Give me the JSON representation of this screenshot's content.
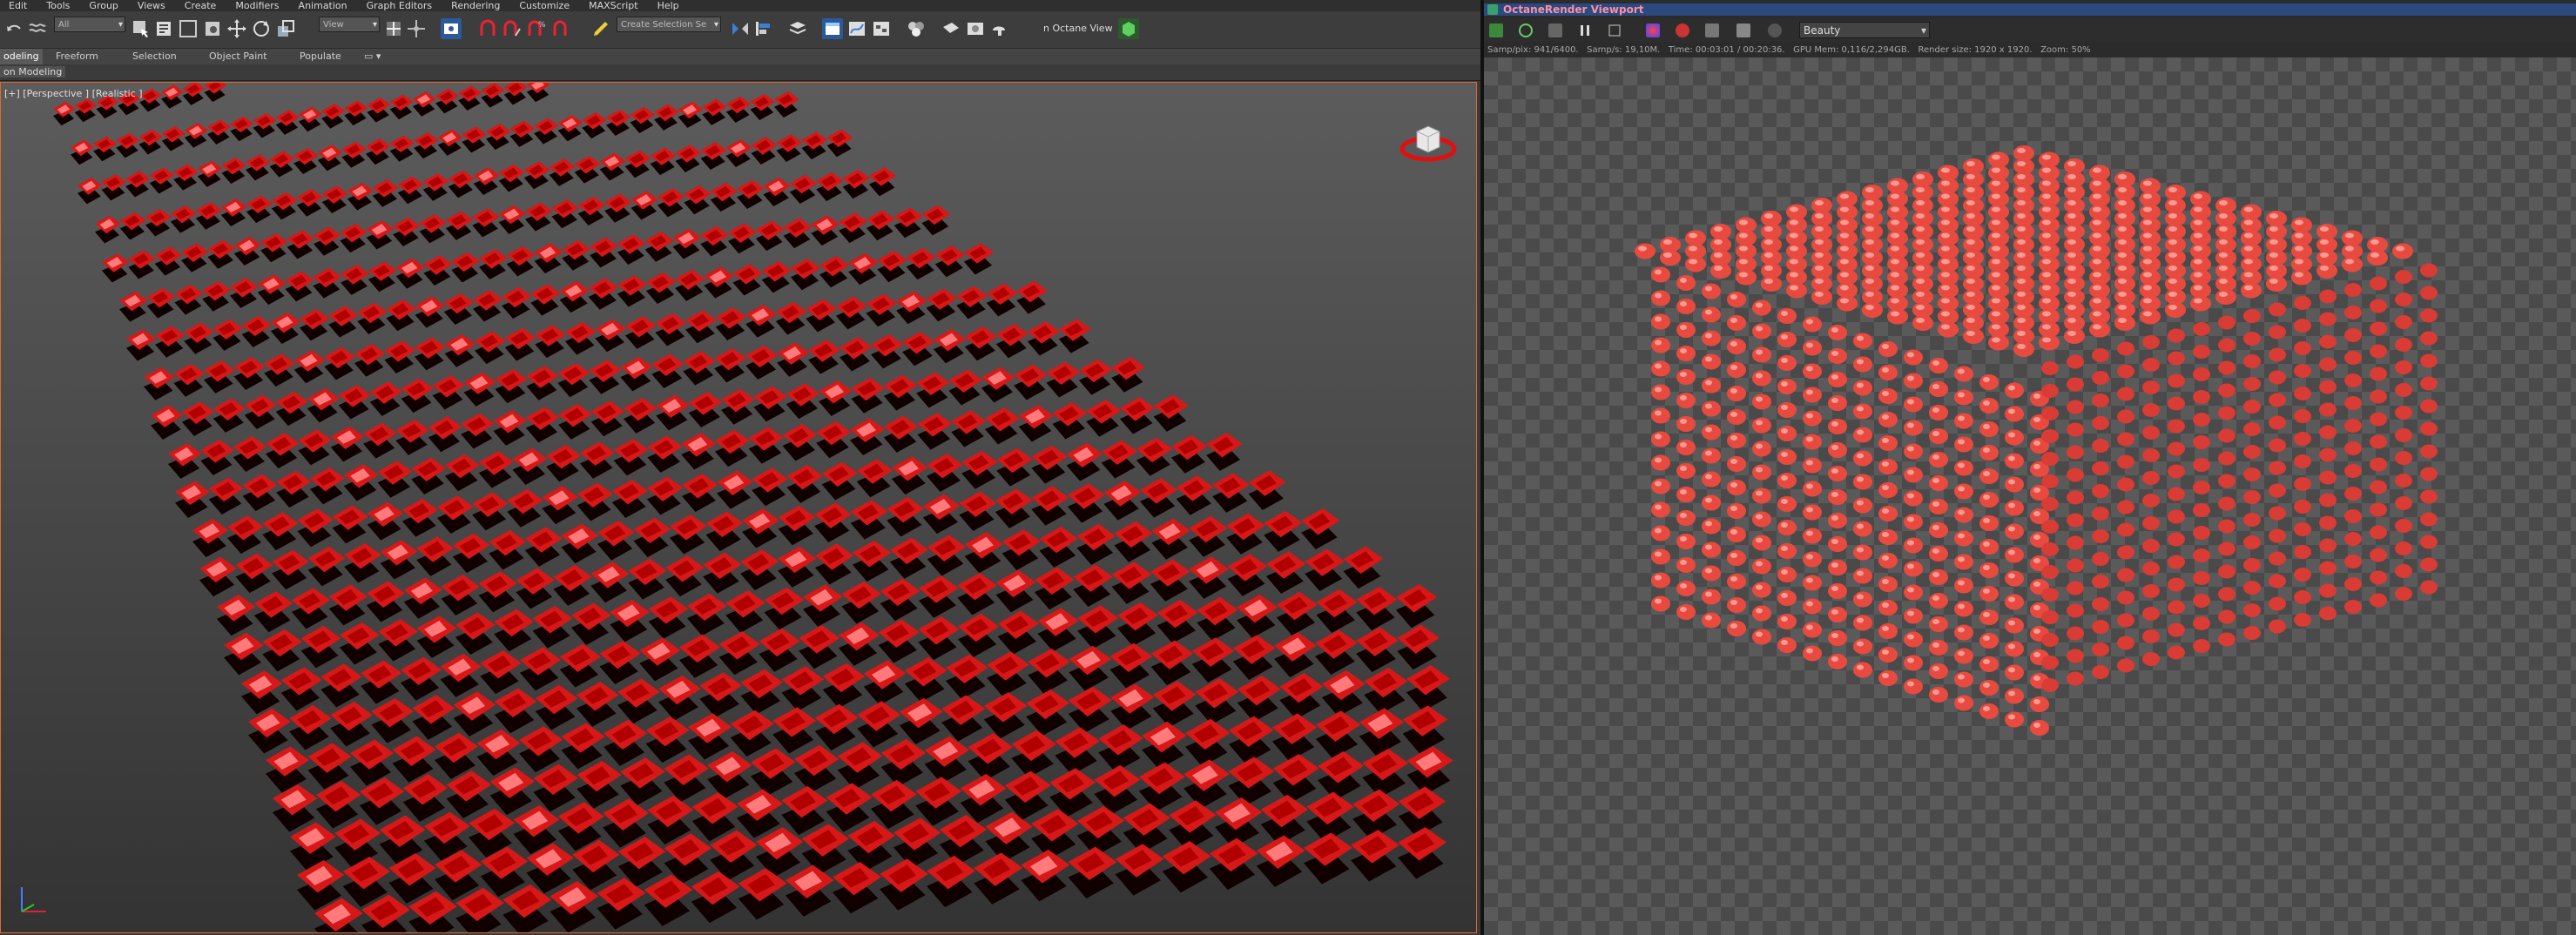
{
  "menu": [
    "Edit",
    "Tools",
    "Group",
    "Views",
    "Create",
    "Modifiers",
    "Animation",
    "Graph Editors",
    "Rendering",
    "Customize",
    "MAXScript",
    "Help"
  ],
  "toolbar": {
    "selection_filter": "All",
    "ref_coord": "View",
    "named_selection": "Create Selection Se",
    "octane_view_label": "n Octane View"
  },
  "ribbon": {
    "tabs": [
      "odeling",
      "Freeform",
      "Selection",
      "Object Paint",
      "Populate"
    ],
    "sub_label": "on Modeling"
  },
  "viewport": {
    "label": "[+] [Perspective ] [Realistic ]",
    "colors": {
      "teapot": "#d61818",
      "teapot_light": "#ff7a7a",
      "shadow": "#100000",
      "frame": "#e5672a"
    }
  },
  "octane": {
    "title": "OctaneRender Viewport",
    "pass_select": "Beauty",
    "status": {
      "samples": "Samp/pix: 941/6400.",
      "speed": "Samp/s: 19,10M.",
      "time": "Time: 00:03:01 / 00:20:36.",
      "gpu_mem": "GPU Mem: 0,116/2,294GB.",
      "render_size": "Render size: 1920 x 1920.",
      "zoom": "Zoom: 50%"
    },
    "colors": {
      "teapot": "#e84a40",
      "teapot_light": "#ff9a90",
      "title_bar": "#2a4a80",
      "title_text": "#ff8fa4"
    }
  }
}
